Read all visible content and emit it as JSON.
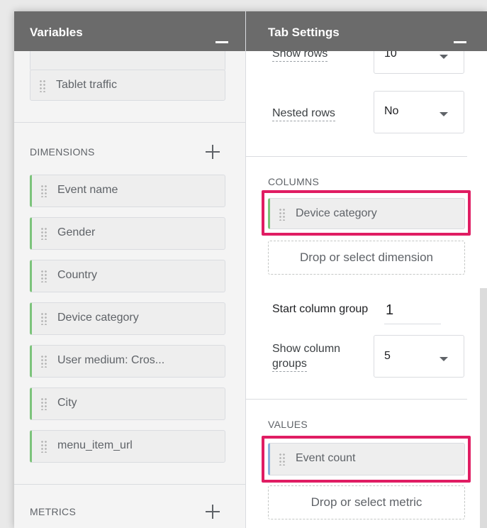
{
  "variables_panel": {
    "title": "Variables",
    "segment_item": "Tablet traffic",
    "dimensions": {
      "label": "DIMENSIONS",
      "items": [
        "Event name",
        "Gender",
        "Country",
        "Device category",
        "User medium: Cros...",
        "City",
        "menu_item_url"
      ]
    },
    "metrics": {
      "label": "METRICS"
    }
  },
  "settings_panel": {
    "title": "Tab Settings",
    "show_rows": {
      "label": "Show rows",
      "value": "10"
    },
    "nested_rows": {
      "label": "Nested rows",
      "value": "No"
    },
    "columns": {
      "label": "COLUMNS",
      "item": "Device category",
      "drop_zone": "Drop or select dimension"
    },
    "start_column_group": {
      "label": "Start column group",
      "value": "1"
    },
    "show_column_groups": {
      "label_line1": "Show column",
      "label_line2": "groups",
      "value": "5"
    },
    "values": {
      "label": "VALUES",
      "item": "Event count",
      "drop_zone": "Drop or select metric"
    }
  },
  "colors": {
    "header": "#6b6b6b",
    "dimension_accent": "#7cc37b",
    "metric_accent": "#8ab0dc",
    "highlight": "#e01d63"
  }
}
